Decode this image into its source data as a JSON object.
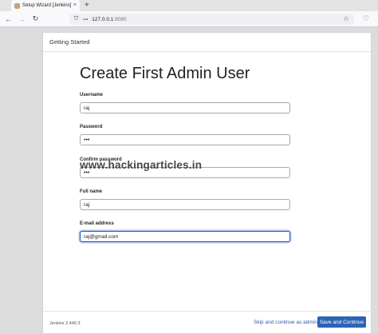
{
  "browser": {
    "tab_title": "Setup Wizard [Jenkins]",
    "tab_close": "×",
    "new_tab": "+",
    "url_host": "127.0.0.1",
    "url_port": ":8080"
  },
  "wizard": {
    "header": "Getting Started",
    "title": "Create First Admin User",
    "fields": [
      {
        "label": "Username",
        "value": "raj"
      },
      {
        "label": "Password",
        "value": "•••"
      },
      {
        "label": "Confirm password",
        "value": "•••"
      },
      {
        "label": "Full name",
        "value": "raj"
      },
      {
        "label": "E-mail address",
        "value": "raj@gmail.com"
      }
    ],
    "version": "Jenkins 2.440.3",
    "skip_label": "Skip and continue as admin",
    "save_label": "Save and Continue"
  },
  "watermark": "www.hackingarticles.in",
  "icons": {
    "back": "back-arrow-icon",
    "forward": "forward-arrow-icon",
    "reload": "reload-icon",
    "star": "bookmark-star-icon"
  }
}
